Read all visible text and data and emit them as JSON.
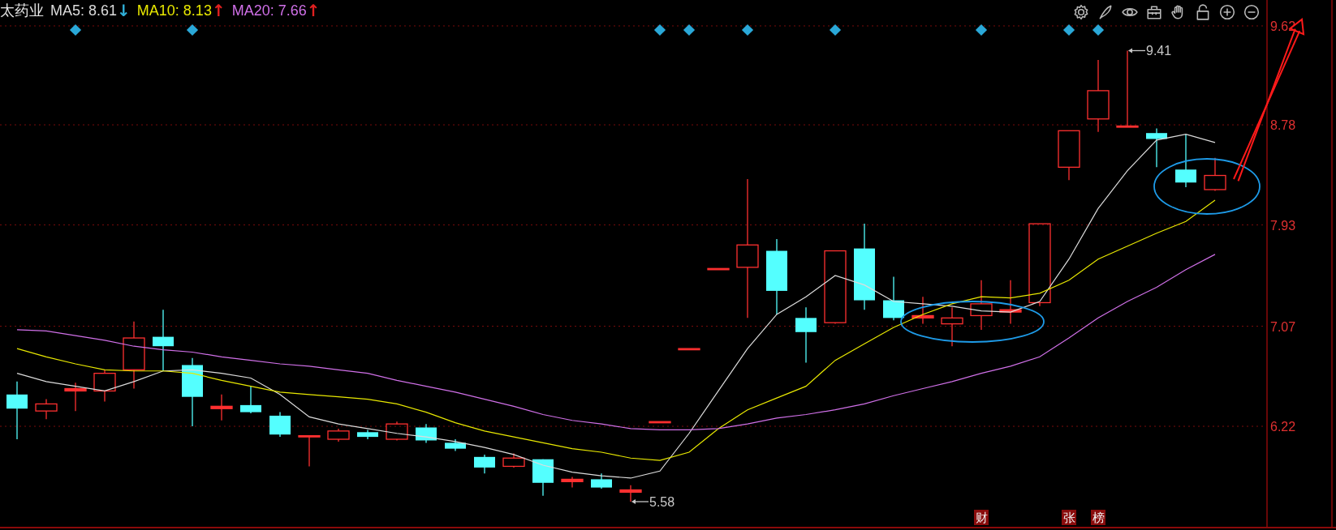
{
  "stock_name": "太药业",
  "ma_readouts": [
    {
      "value": "8.61",
      "arrow": {
        "text": "↓",
        "color": "#30b0d8"
      }
    },
    {
      "value": "8.13",
      "arrow": {
        "text": "↑",
        "color": "#e02020"
      }
    },
    {
      "value": "7.66",
      "arrow": {
        "text": "↑",
        "color": "#e02020"
      }
    }
  ],
  "event_tags": [
    "财",
    "张",
    "榜"
  ],
  "chart_data": {
    "type": "line",
    "ylim": [
      5.36,
      9.84
    ],
    "yticks": [
      6.22,
      7.07,
      7.93,
      8.78,
      9.62
    ],
    "grid": true,
    "series": [
      {
        "name": "MA5:",
        "color": "#dcdcdc",
        "values": [
          6.67,
          6.6,
          6.56,
          6.52,
          6.6,
          6.69,
          6.7,
          6.67,
          6.63,
          6.49,
          6.3,
          6.24,
          6.2,
          6.16,
          6.13,
          6.09,
          6.04,
          5.98,
          5.89,
          5.83,
          5.8,
          5.78,
          5.84,
          6.16,
          6.52,
          6.88,
          7.17,
          7.32,
          7.5,
          7.42,
          7.28,
          7.26,
          7.24,
          7.2,
          7.19,
          7.28,
          7.64,
          8.07,
          8.39,
          8.65,
          8.7,
          8.63
        ]
      },
      {
        "name": "MA10:",
        "color": "#e8e800",
        "values": [
          6.88,
          6.81,
          6.75,
          6.7,
          6.69,
          6.69,
          6.67,
          6.61,
          6.56,
          6.51,
          6.49,
          6.47,
          6.45,
          6.41,
          6.34,
          6.25,
          6.18,
          6.13,
          6.08,
          6.03,
          6.0,
          5.95,
          5.93,
          6.0,
          6.2,
          6.36,
          6.46,
          6.56,
          6.78,
          6.92,
          7.06,
          7.17,
          7.26,
          7.32,
          7.31,
          7.35,
          7.46,
          7.64,
          7.75,
          7.86,
          7.96,
          8.14
        ]
      },
      {
        "name": "MA20:",
        "color": "#d070e8",
        "values": [
          7.04,
          7.03,
          6.99,
          6.95,
          6.9,
          6.87,
          6.85,
          6.81,
          6.78,
          6.75,
          6.73,
          6.7,
          6.67,
          6.61,
          6.56,
          6.51,
          6.45,
          6.39,
          6.32,
          6.27,
          6.24,
          6.2,
          6.19,
          6.19,
          6.2,
          6.24,
          6.29,
          6.32,
          6.36,
          6.41,
          6.48,
          6.54,
          6.6,
          6.67,
          6.73,
          6.81,
          6.97,
          7.14,
          7.28,
          7.4,
          7.55,
          7.68
        ]
      }
    ],
    "annotations": [
      {
        "text": "9.41"
      },
      {
        "text": "5.58"
      }
    ]
  }
}
